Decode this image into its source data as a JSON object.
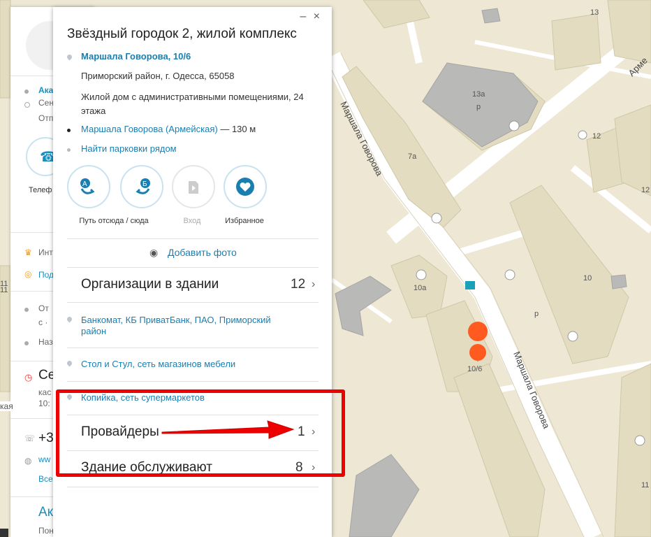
{
  "left_panel": {
    "items": [
      "Ака",
      "Сен",
      "Отп",
      "Телеф",
      "Инт",
      "Под",
      "От",
      "с ·",
      "Наз",
      "Сег",
      "кас",
      "10:",
      "+3",
      "ww",
      "Все",
      "Ак",
      "Пон"
    ],
    "edge_labels": [
      "11",
      "кая"
    ]
  },
  "card": {
    "controls": "– ×",
    "title": "Звёздный городок 2, жилой комплекс",
    "address_link": "Маршала Говорова, 10/6",
    "region": "Приморский район, г. Одесса, 65058",
    "description": "Жилой дом с административными помещениями, 24 этажа",
    "stop_link": "Маршала Говорова (Армейская)",
    "stop_distance": "— 130 м",
    "parking_link": "Найти парковки рядом",
    "buttons": [
      {
        "label": "Путь отсюда / сюда",
        "icon": "route-icon"
      },
      {
        "label": "Вход",
        "icon": "entrance-icon"
      },
      {
        "label": "Избранное",
        "icon": "heart-icon"
      }
    ],
    "add_photo": "Добавить фото",
    "orgs_section": {
      "title": "Организации в здании",
      "count": "12"
    },
    "orgs": [
      "Банкомат, КБ ПриватБанк, ПАО, Приморский район",
      "Стол и Стул, сеть магазинов мебели",
      "Копийка, сеть супермаркетов"
    ],
    "providers": {
      "title": "Провайдеры",
      "count": "1"
    },
    "service": {
      "title": "Здание обслуживают",
      "count": "8"
    }
  },
  "map": {
    "street_labels": [
      "Маршала Говорова",
      "Маршала Говорова",
      "Арме"
    ],
    "house_numbers": [
      "13",
      "13а",
      "р",
      "7а",
      "12",
      "12",
      "10а",
      "10",
      "10/6",
      "р",
      "11",
      "11"
    ],
    "colors": {
      "accent": "#1a7eb0",
      "highlight": "#e00000",
      "marker": "#ff5a1f"
    }
  },
  "annotation": {
    "arrow_color": "#e00000",
    "box_color": "#e00000"
  }
}
